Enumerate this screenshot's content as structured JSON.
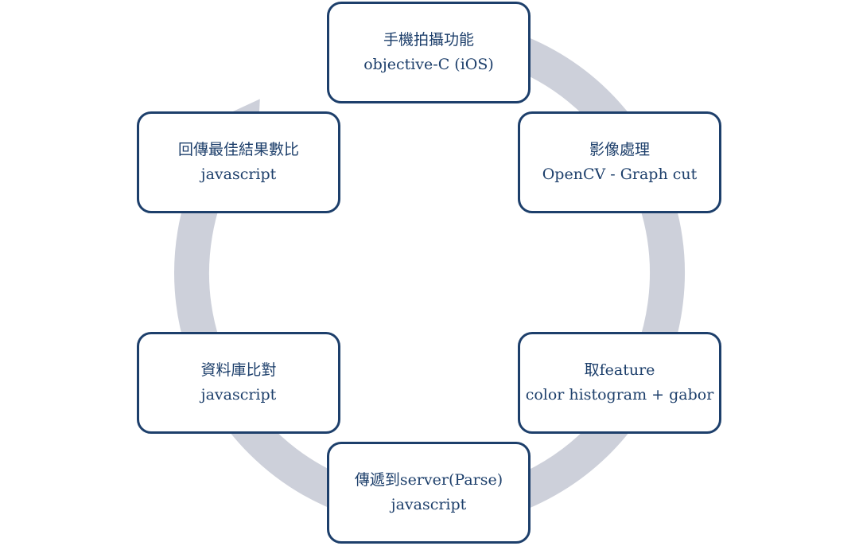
{
  "colors": {
    "ring": "#cdd0da",
    "box_border": "#1d3f6b",
    "box_fill": "#ffffff",
    "text": "#1d3f6b"
  },
  "cycle": {
    "arrow_direction": "clockwise",
    "steps": [
      {
        "title": "手機拍攝功能",
        "subtitle": "objective-C (iOS)"
      },
      {
        "title": "影像處理",
        "subtitle": "OpenCV - Graph cut"
      },
      {
        "title": "取feature",
        "subtitle": "color histogram + gabor"
      },
      {
        "title": "傳遞到server(Parse)",
        "subtitle": "javascript"
      },
      {
        "title": "資料庫比對",
        "subtitle": "javascript"
      },
      {
        "title": "回傳最佳結果數比",
        "subtitle": "javascript"
      }
    ]
  }
}
